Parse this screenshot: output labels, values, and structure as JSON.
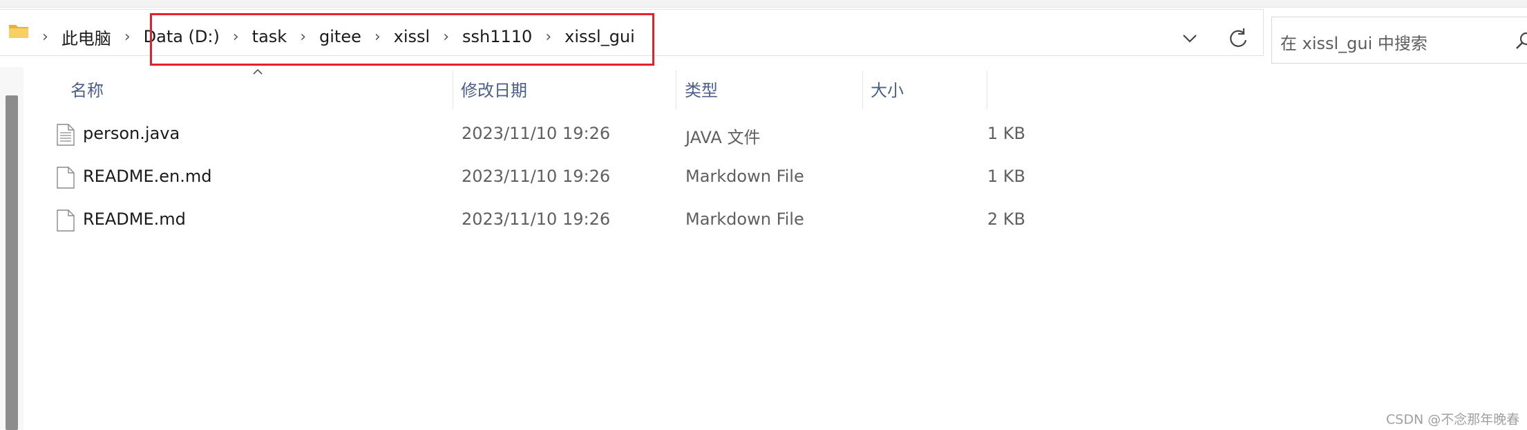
{
  "breadcrumb": {
    "items": [
      "此电脑",
      "Data (D:)",
      "task",
      "gitee",
      "xissl",
      "ssh1110",
      "xissl_gui"
    ]
  },
  "search": {
    "placeholder": "在 xissl_gui 中搜索"
  },
  "columns": {
    "name": "名称",
    "date": "修改日期",
    "type": "类型",
    "size": "大小"
  },
  "files": [
    {
      "name": "person.java",
      "date": "2023/11/10 19:26",
      "type": "JAVA 文件",
      "size": "1 KB",
      "icon": "text-file-icon"
    },
    {
      "name": "README.en.md",
      "date": "2023/11/10 19:26",
      "type": "Markdown File",
      "size": "1 KB",
      "icon": "blank-file-icon"
    },
    {
      "name": "README.md",
      "date": "2023/11/10 19:26",
      "type": "Markdown File",
      "size": "2 KB",
      "icon": "blank-file-icon"
    }
  ],
  "watermark": "CSDN @不念那年晚春",
  "colors": {
    "highlight": "#e6202a",
    "header_text": "#4a5e8a",
    "folder": "#f2c55c"
  }
}
